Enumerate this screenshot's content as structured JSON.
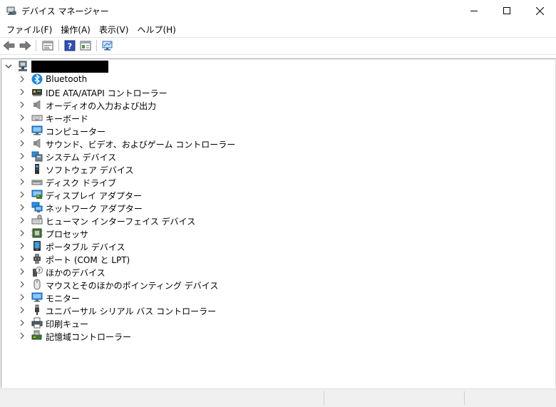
{
  "window": {
    "title": "デバイス マネージャー"
  },
  "menu": [
    {
      "label": "ファイル(F)"
    },
    {
      "label": "操作(A)"
    },
    {
      "label": "表示(V)"
    },
    {
      "label": "ヘルプ(H)"
    }
  ],
  "toolbar": {
    "buttons": [
      {
        "icon": "back-arrow-icon"
      },
      {
        "icon": "forward-arrow-icon"
      },
      {
        "icon": "properties-icon"
      },
      {
        "icon": "help-icon"
      },
      {
        "icon": "show-hide-console-tree-icon"
      },
      {
        "icon": "scan-hardware-icon"
      }
    ]
  },
  "tree": {
    "root": {
      "icon": "computer-root-icon",
      "label_redacted": true
    },
    "categories": [
      {
        "label": "Bluetooth",
        "icon": "bluetooth-icon"
      },
      {
        "label": "IDE ATA/ATAPI コントローラー",
        "icon": "ide-controller-icon"
      },
      {
        "label": "オーディオの入力および出力",
        "icon": "speaker-icon"
      },
      {
        "label": "キーボード",
        "icon": "keyboard-icon"
      },
      {
        "label": "コンピューター",
        "icon": "computer-icon"
      },
      {
        "label": "サウンド、ビデオ、およびゲーム コントローラー",
        "icon": "sound-icon"
      },
      {
        "label": "システム デバイス",
        "icon": "system-device-icon"
      },
      {
        "label": "ソフトウェア デバイス",
        "icon": "software-device-icon"
      },
      {
        "label": "ディスク ドライブ",
        "icon": "disk-drive-icon"
      },
      {
        "label": "ディスプレイ アダプター",
        "icon": "display-adapter-icon"
      },
      {
        "label": "ネットワーク アダプター",
        "icon": "network-adapter-icon"
      },
      {
        "label": "ヒューマン インターフェイス デバイス",
        "icon": "hid-icon"
      },
      {
        "label": "プロセッサ",
        "icon": "processor-icon"
      },
      {
        "label": "ポータブル デバイス",
        "icon": "portable-device-icon"
      },
      {
        "label": "ポート (COM と LPT)",
        "icon": "port-icon"
      },
      {
        "label": "ほかのデバイス",
        "icon": "other-device-icon"
      },
      {
        "label": "マウスとそのほかのポインティング デバイス",
        "icon": "mouse-icon"
      },
      {
        "label": "モニター",
        "icon": "monitor-icon"
      },
      {
        "label": "ユニバーサル シリアル バス コントローラー",
        "icon": "usb-icon"
      },
      {
        "label": "印刷キュー",
        "icon": "printer-icon"
      },
      {
        "label": "記憶域コントローラー",
        "icon": "storage-controller-icon"
      }
    ]
  },
  "colors": {
    "accent_blue": "#1e88d8",
    "tree_border": "#a0a0a0",
    "status_bg": "#f0f0f0"
  }
}
